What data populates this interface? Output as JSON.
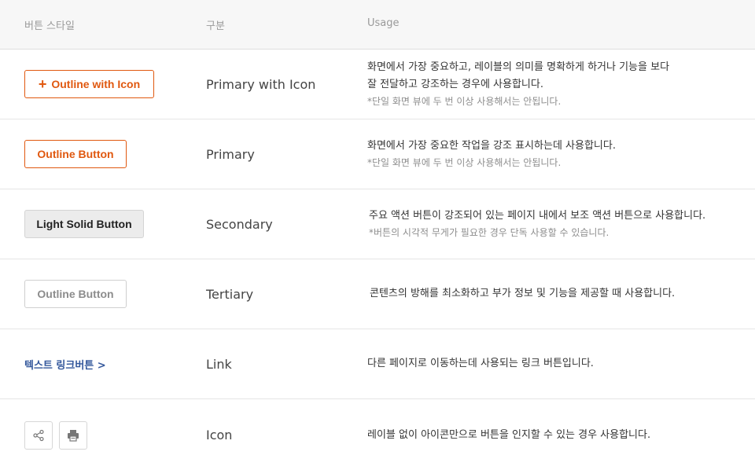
{
  "header": {
    "style": "버튼 스타일",
    "kind": "구분",
    "usage": "Usage"
  },
  "rows": [
    {
      "button_label": "Outline with Icon",
      "kind": "Primary with Icon",
      "usage_line1": "화면에서 가장 중요하고, 레이블의 의미를 명확하게 하거나 기능을 보다",
      "usage_line2": "잘 전달하고 강조하는 경우에 사용합니다.",
      "note": "*단일 화면 뷰에 두 번 이상 사용해서는 안됩니다."
    },
    {
      "button_label": "Outline Button",
      "kind": "Primary",
      "usage_line1": "화면에서 가장 중요한 작업을  강조 표시하는데 사용합니다.",
      "note": "*단일 화면 뷰에 두 번 이상 사용해서는 안됩니다."
    },
    {
      "button_label": "Light Solid Button",
      "kind": "Secondary",
      "usage_line1": "주요 액션 버튼이 강조되어 있는 페이지 내에서 보조 액션 버튼으로 사용합니다.",
      "note": "*버튼의 시각적 무게가 필요한 경우 단독 사용할 수 있습니다."
    },
    {
      "button_label": "Outline Button",
      "kind": "Tertiary",
      "usage_line1": "콘텐츠의 방해를 최소화하고 부가 정보 및 기능을 제공할 때 사용합니다."
    },
    {
      "button_label": "텍스트 링크버튼 >",
      "kind": "Link",
      "usage_line1": "다른 페이지로 이동하는데 사용되는 링크 버튼입니다."
    },
    {
      "kind": "Icon",
      "usage_line1": "레이블 없이 아이콘만으로 버튼을 인지할 수 있는 경우 사용합니다.",
      "icons": [
        "share-icon",
        "print-icon"
      ]
    }
  ],
  "colors": {
    "primary": "#e0580f",
    "link": "#34589c",
    "header_bg": "#f7f7f7"
  }
}
